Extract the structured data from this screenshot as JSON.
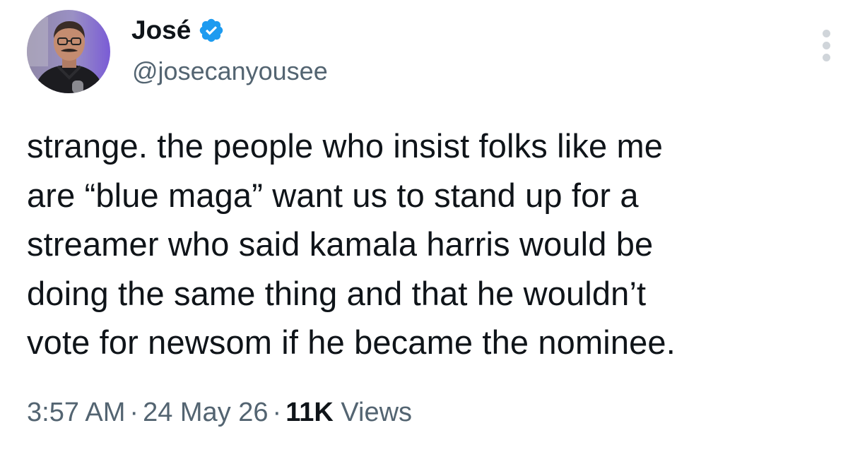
{
  "author": {
    "display_name": "José",
    "handle": "@josecanyousee",
    "verified": true,
    "verified_badge_icon": "verified-badge-icon",
    "verified_color": "#1d9bf0"
  },
  "more_options_icon": "more-vertical-icon",
  "tweet": {
    "lines": [
      "strange. the people who insist folks like me",
      "are “blue maga” want us to stand up for a",
      "streamer who said kamala harris would be",
      "doing the same thing and that he wouldn’t",
      "vote for newsom if he became the nominee."
    ]
  },
  "meta": {
    "time": "3:57 AM",
    "separator": "·",
    "date": "24 May 26",
    "views_count": "11K",
    "views_label": "Views"
  },
  "colors": {
    "text_primary": "#0f1419",
    "text_secondary": "#536471",
    "accent": "#1d9bf0"
  }
}
